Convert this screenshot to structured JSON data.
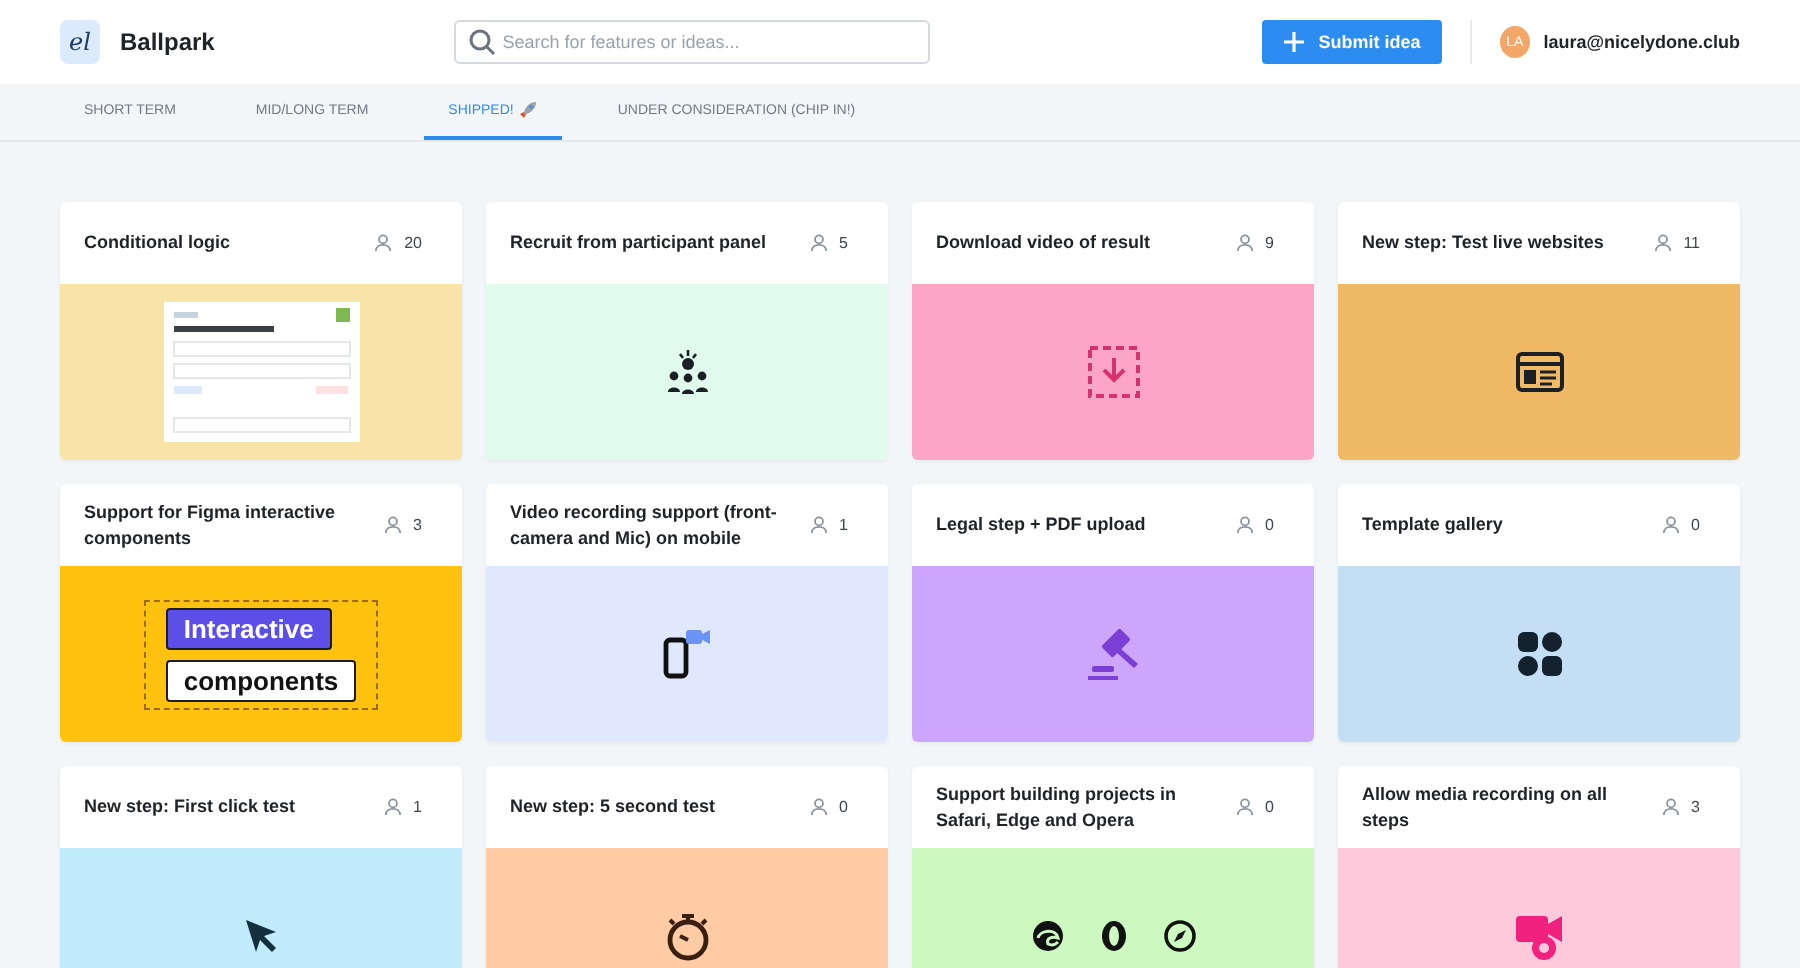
{
  "header": {
    "logo_letter": "el",
    "title": "Ballpark",
    "search": {
      "placeholder": "Search for features or ideas..."
    },
    "submit_button": "Submit idea",
    "user": {
      "initials": "LA",
      "email": "laura@nicelydone.club"
    }
  },
  "tabs": [
    {
      "label": "SHORT TERM",
      "selected": false,
      "kind": "plain"
    },
    {
      "label": "MID/LONG TERM",
      "selected": false,
      "kind": "plain"
    },
    {
      "label": "SHIPPED!",
      "selected": true,
      "kind": "rocket"
    },
    {
      "label": "UNDER CONSIDERATION (CHIP IN!)",
      "selected": false,
      "kind": "plain"
    }
  ],
  "cards": [
    {
      "title": "Conditional logic",
      "votes": "20",
      "color": "#f9e4a7",
      "kind": "form"
    },
    {
      "title": "Recruit from participant panel",
      "votes": "5",
      "color": "#e0fbee",
      "kind": "people"
    },
    {
      "title": "Download video of result",
      "votes": "9",
      "color": "#fda5c5",
      "kind": "download"
    },
    {
      "title": "New step: Test live websites",
      "votes": "11",
      "color": "#f0b966",
      "kind": "browser"
    },
    {
      "title": "Support for Figma interactive components",
      "votes": "3",
      "color": "#ffc20e",
      "kind": "figma",
      "image_labels": [
        "Interactive",
        "components"
      ]
    },
    {
      "title": "Video recording support (front-camera and Mic) on mobile",
      "votes": "1",
      "color": "#dfe8fd",
      "kind": "phone"
    },
    {
      "title": "Legal step + PDF upload",
      "votes": "0",
      "color": "#cda5fb",
      "kind": "gavel"
    },
    {
      "title": "Template gallery",
      "votes": "0",
      "color": "#c3def5",
      "kind": "grid"
    },
    {
      "title": "New step: First click test",
      "votes": "1",
      "color": "#c0ebfb",
      "kind": "cursor"
    },
    {
      "title": "New step: 5 second test",
      "votes": "0",
      "color": "#fecba4",
      "kind": "stopwatch"
    },
    {
      "title": "Support building projects in Safari, Edge and Opera",
      "votes": "0",
      "color": "#cdf9c1",
      "kind": "browsers"
    },
    {
      "title": "Allow media recording on all steps",
      "votes": "3",
      "color": "#ffc9dc",
      "kind": "media"
    }
  ]
}
